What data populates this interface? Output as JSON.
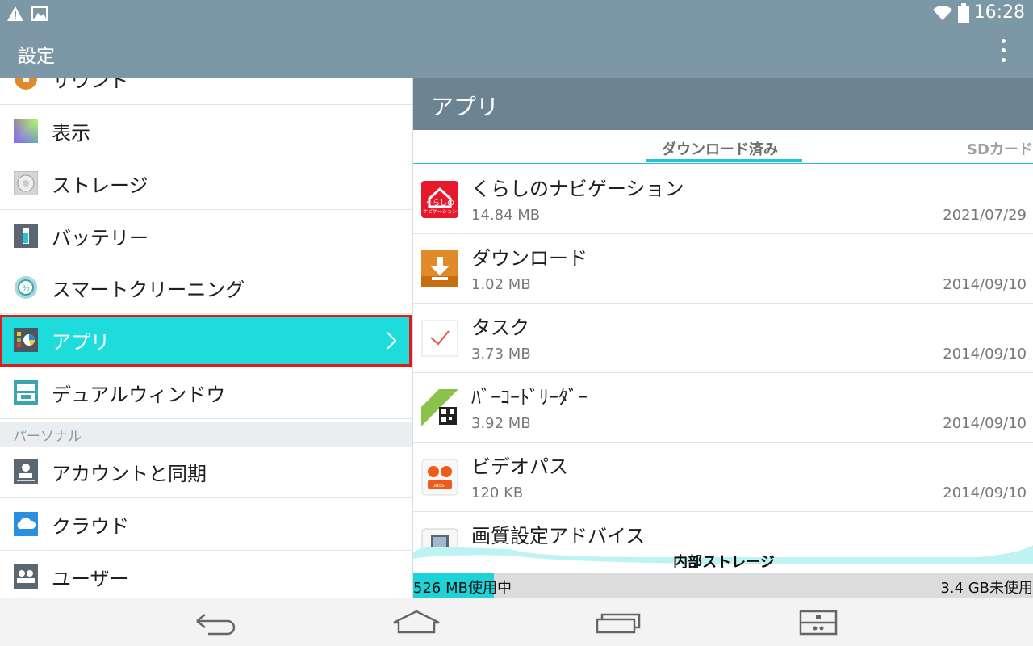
{
  "status_bar": {
    "time": "16:28",
    "icons": [
      "warning-icon",
      "image-icon",
      "wifi-icon",
      "battery-icon"
    ]
  },
  "action_bar": {
    "title": "設定",
    "overflow_icon": "more-vert-icon"
  },
  "settings": {
    "partial_item": "サウンド",
    "items": [
      {
        "label": "表示",
        "icon": "display-icon"
      },
      {
        "label": "ストレージ",
        "icon": "storage-icon"
      },
      {
        "label": "バッテリー",
        "icon": "battery-icon"
      },
      {
        "label": "スマートクリーニング",
        "icon": "smart-cleaning-icon"
      },
      {
        "label": "アプリ",
        "icon": "apps-icon",
        "selected": true
      },
      {
        "label": "デュアルウィンドウ",
        "icon": "dual-window-icon"
      }
    ],
    "section_personal": "パーソナル",
    "personal_items": [
      {
        "label": "アカウントと同期",
        "icon": "account-sync-icon"
      },
      {
        "label": "クラウド",
        "icon": "cloud-icon"
      },
      {
        "label": "ユーザー",
        "icon": "users-icon"
      }
    ]
  },
  "apps_panel": {
    "title": "アプリ",
    "tabs": {
      "downloaded": "ダウンロード済み",
      "sd_card": "SDカード"
    },
    "apps": [
      {
        "name": "くらしのナビゲーション",
        "size": "14.84 MB",
        "date": "2021/07/29",
        "icon": "kurashi-navi-icon"
      },
      {
        "name": "ダウンロード",
        "size": "1.02 MB",
        "date": "2014/09/10",
        "icon": "download-icon"
      },
      {
        "name": "タスク",
        "size": "3.73 MB",
        "date": "2014/09/10",
        "icon": "task-icon"
      },
      {
        "name": "ﾊﾞｰｺｰﾄﾞﾘｰﾀﾞｰ",
        "size": "3.92 MB",
        "date": "2014/09/10",
        "icon": "barcode-reader-icon"
      },
      {
        "name": "ビデオパス",
        "size": "120 KB",
        "date": "2014/09/10",
        "icon": "video-pass-icon"
      },
      {
        "name": "画質設定アドバイス",
        "icon": "image-quality-icon"
      }
    ],
    "storage": {
      "title": "内部ストレージ",
      "used": "526 MB使用中",
      "free": "3.4 GB未使用",
      "used_fraction": 0.13
    }
  },
  "nav_bar": {
    "buttons": [
      "back-icon",
      "home-icon",
      "recents-icon",
      "dual-window-toggle-icon"
    ]
  }
}
